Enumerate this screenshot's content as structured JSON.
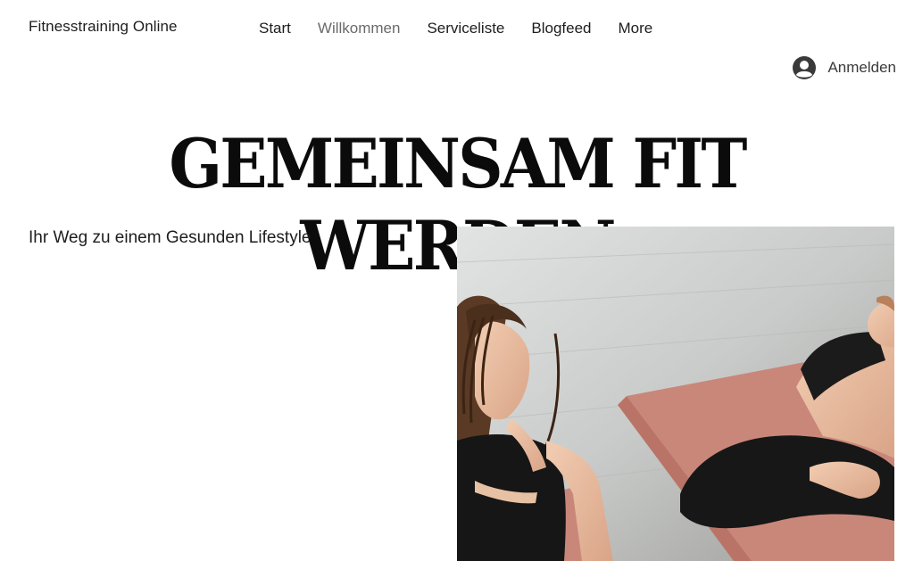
{
  "site": {
    "name": "Fitnesstraining Online"
  },
  "nav": {
    "items": [
      {
        "label": "Start"
      },
      {
        "label": "Willkommen"
      },
      {
        "label": "Serviceliste"
      },
      {
        "label": "Blogfeed"
      },
      {
        "label": "More"
      }
    ],
    "active": "Willkommen"
  },
  "login": {
    "label": "Anmelden",
    "icon": "user-avatar-icon"
  },
  "hero": {
    "title": "GEMEINSAM FIT WERDEN",
    "subtitle": "Ihr Weg zu einem Gesunden Lifestyle",
    "image_subject": "two-women-stretching-on-yoga-mats"
  },
  "colors": {
    "text": "#1d1d1d",
    "active_nav": "#6a6a6a",
    "background": "#ffffff",
    "mat": "#c9877a"
  }
}
